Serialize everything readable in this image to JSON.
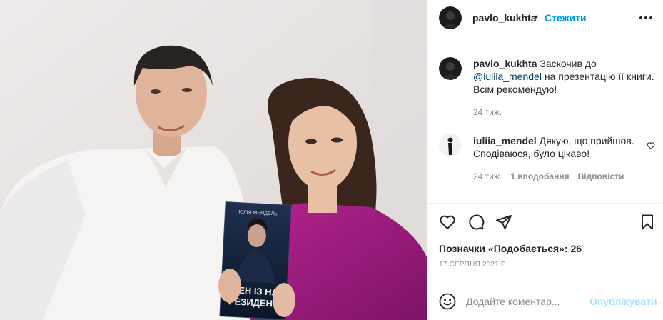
{
  "post": {
    "author": "pavlo_kukhta",
    "separator": "•",
    "follow_label": "Стежити"
  },
  "book": {
    "author_text": "ЮЛІЯ МЕНДЕЛЬ",
    "title_line1": "ОЖЕН ІЗ НАС",
    "title_line2": "РЕЗИДЕНТ"
  },
  "caption": {
    "username": "pavlo_kukhta",
    "text_before": " Заскочив до ",
    "mention": "@iuliia_mendel",
    "text_after": " на презентацію її книги. Всім рекомендую!",
    "time": "24 тиж."
  },
  "comments": [
    {
      "username": "iuliia_mendel",
      "text": " Дякую, що прийшов. Сподіваюся, було цікаво!",
      "time": "24 тиж.",
      "likes": "1 вподобання",
      "reply_label": "Відповісти"
    }
  ],
  "actions": {
    "likes_label": "Позначки «Подобається»: 26",
    "date": "17 СЕРПНЯ 2021 Р."
  },
  "composer": {
    "placeholder": "Додайте коментар...",
    "publish_label": "Опублікувати"
  },
  "icons": {
    "like": "heart-icon",
    "comment": "comment-icon",
    "share": "paper-plane-icon",
    "save": "bookmark-icon",
    "more": "more-horizontal-icon",
    "emoji": "emoji-icon"
  },
  "colors": {
    "accent": "#0095f6",
    "publish_disabled": "#b2dffc",
    "mention": "#00376b",
    "secondary_text": "#8e8e8e"
  }
}
